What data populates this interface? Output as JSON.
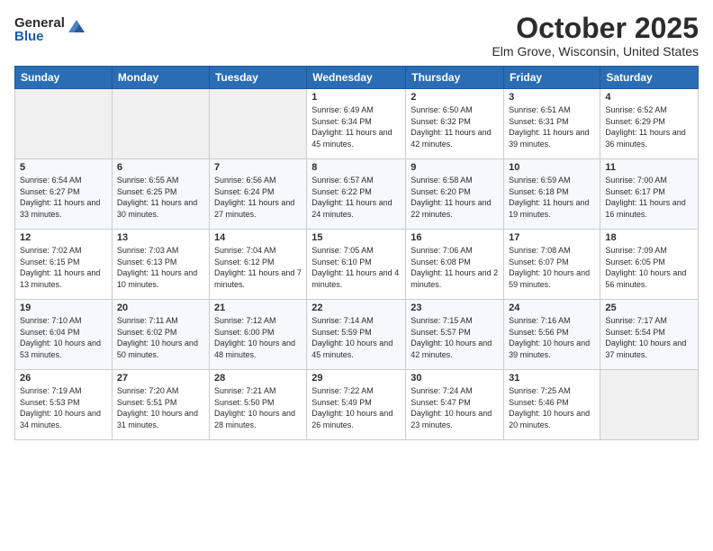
{
  "logo": {
    "general": "General",
    "blue": "Blue"
  },
  "header": {
    "month": "October 2025",
    "location": "Elm Grove, Wisconsin, United States"
  },
  "weekdays": [
    "Sunday",
    "Monday",
    "Tuesday",
    "Wednesday",
    "Thursday",
    "Friday",
    "Saturday"
  ],
  "weeks": [
    [
      {
        "day": "",
        "info": ""
      },
      {
        "day": "",
        "info": ""
      },
      {
        "day": "",
        "info": ""
      },
      {
        "day": "1",
        "info": "Sunrise: 6:49 AM\nSunset: 6:34 PM\nDaylight: 11 hours and 45 minutes."
      },
      {
        "day": "2",
        "info": "Sunrise: 6:50 AM\nSunset: 6:32 PM\nDaylight: 11 hours and 42 minutes."
      },
      {
        "day": "3",
        "info": "Sunrise: 6:51 AM\nSunset: 6:31 PM\nDaylight: 11 hours and 39 minutes."
      },
      {
        "day": "4",
        "info": "Sunrise: 6:52 AM\nSunset: 6:29 PM\nDaylight: 11 hours and 36 minutes."
      }
    ],
    [
      {
        "day": "5",
        "info": "Sunrise: 6:54 AM\nSunset: 6:27 PM\nDaylight: 11 hours and 33 minutes."
      },
      {
        "day": "6",
        "info": "Sunrise: 6:55 AM\nSunset: 6:25 PM\nDaylight: 11 hours and 30 minutes."
      },
      {
        "day": "7",
        "info": "Sunrise: 6:56 AM\nSunset: 6:24 PM\nDaylight: 11 hours and 27 minutes."
      },
      {
        "day": "8",
        "info": "Sunrise: 6:57 AM\nSunset: 6:22 PM\nDaylight: 11 hours and 24 minutes."
      },
      {
        "day": "9",
        "info": "Sunrise: 6:58 AM\nSunset: 6:20 PM\nDaylight: 11 hours and 22 minutes."
      },
      {
        "day": "10",
        "info": "Sunrise: 6:59 AM\nSunset: 6:18 PM\nDaylight: 11 hours and 19 minutes."
      },
      {
        "day": "11",
        "info": "Sunrise: 7:00 AM\nSunset: 6:17 PM\nDaylight: 11 hours and 16 minutes."
      }
    ],
    [
      {
        "day": "12",
        "info": "Sunrise: 7:02 AM\nSunset: 6:15 PM\nDaylight: 11 hours and 13 minutes."
      },
      {
        "day": "13",
        "info": "Sunrise: 7:03 AM\nSunset: 6:13 PM\nDaylight: 11 hours and 10 minutes."
      },
      {
        "day": "14",
        "info": "Sunrise: 7:04 AM\nSunset: 6:12 PM\nDaylight: 11 hours and 7 minutes."
      },
      {
        "day": "15",
        "info": "Sunrise: 7:05 AM\nSunset: 6:10 PM\nDaylight: 11 hours and 4 minutes."
      },
      {
        "day": "16",
        "info": "Sunrise: 7:06 AM\nSunset: 6:08 PM\nDaylight: 11 hours and 2 minutes."
      },
      {
        "day": "17",
        "info": "Sunrise: 7:08 AM\nSunset: 6:07 PM\nDaylight: 10 hours and 59 minutes."
      },
      {
        "day": "18",
        "info": "Sunrise: 7:09 AM\nSunset: 6:05 PM\nDaylight: 10 hours and 56 minutes."
      }
    ],
    [
      {
        "day": "19",
        "info": "Sunrise: 7:10 AM\nSunset: 6:04 PM\nDaylight: 10 hours and 53 minutes."
      },
      {
        "day": "20",
        "info": "Sunrise: 7:11 AM\nSunset: 6:02 PM\nDaylight: 10 hours and 50 minutes."
      },
      {
        "day": "21",
        "info": "Sunrise: 7:12 AM\nSunset: 6:00 PM\nDaylight: 10 hours and 48 minutes."
      },
      {
        "day": "22",
        "info": "Sunrise: 7:14 AM\nSunset: 5:59 PM\nDaylight: 10 hours and 45 minutes."
      },
      {
        "day": "23",
        "info": "Sunrise: 7:15 AM\nSunset: 5:57 PM\nDaylight: 10 hours and 42 minutes."
      },
      {
        "day": "24",
        "info": "Sunrise: 7:16 AM\nSunset: 5:56 PM\nDaylight: 10 hours and 39 minutes."
      },
      {
        "day": "25",
        "info": "Sunrise: 7:17 AM\nSunset: 5:54 PM\nDaylight: 10 hours and 37 minutes."
      }
    ],
    [
      {
        "day": "26",
        "info": "Sunrise: 7:19 AM\nSunset: 5:53 PM\nDaylight: 10 hours and 34 minutes."
      },
      {
        "day": "27",
        "info": "Sunrise: 7:20 AM\nSunset: 5:51 PM\nDaylight: 10 hours and 31 minutes."
      },
      {
        "day": "28",
        "info": "Sunrise: 7:21 AM\nSunset: 5:50 PM\nDaylight: 10 hours and 28 minutes."
      },
      {
        "day": "29",
        "info": "Sunrise: 7:22 AM\nSunset: 5:49 PM\nDaylight: 10 hours and 26 minutes."
      },
      {
        "day": "30",
        "info": "Sunrise: 7:24 AM\nSunset: 5:47 PM\nDaylight: 10 hours and 23 minutes."
      },
      {
        "day": "31",
        "info": "Sunrise: 7:25 AM\nSunset: 5:46 PM\nDaylight: 10 hours and 20 minutes."
      },
      {
        "day": "",
        "info": ""
      }
    ]
  ]
}
